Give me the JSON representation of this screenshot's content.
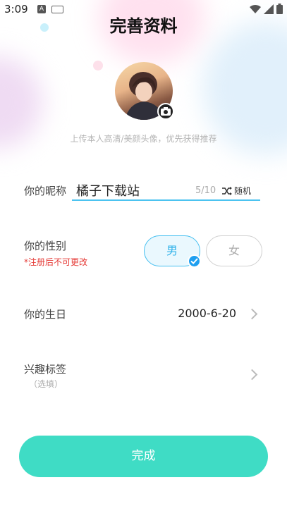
{
  "status_bar": {
    "time": "3:09",
    "badge": "A"
  },
  "header": {
    "title": "完善资料"
  },
  "avatar": {
    "hint": "上传本人高清/美颜头像，优先获得推荐"
  },
  "nickname": {
    "label": "你的昵称",
    "value": "橘子下载站",
    "count": "5/10",
    "random_label": "随机"
  },
  "gender": {
    "label": "你的性别",
    "note": "*注册后不可更改",
    "male": "男",
    "female": "女",
    "selected": "男"
  },
  "birthday": {
    "label": "你的生日",
    "value": "2000-6-20"
  },
  "tags": {
    "label": "兴趣标签",
    "sub": "（选填）"
  },
  "actions": {
    "done": "完成"
  },
  "colors": {
    "accent": "#3fdcc5",
    "selected_blue": "#44bff0",
    "warning": "#e53935"
  }
}
